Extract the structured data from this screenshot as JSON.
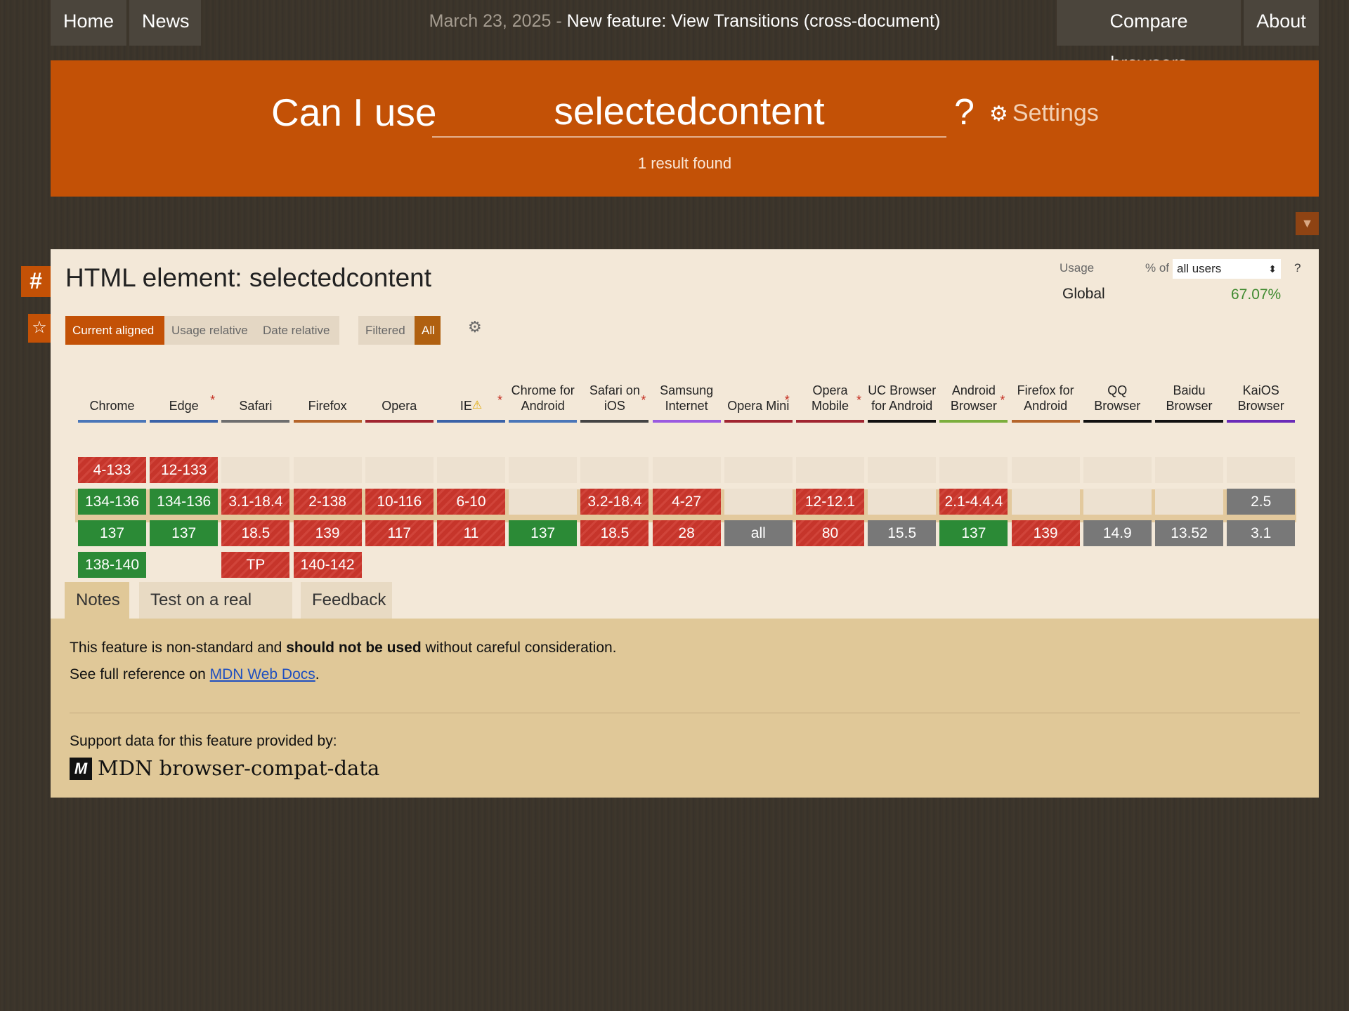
{
  "nav": {
    "home": "Home",
    "news": "News",
    "compare": "Compare browsers",
    "about": "About",
    "announce_date": "March 23, 2025 - ",
    "announce_text": "New feature: View Transitions (cross-document)"
  },
  "hero": {
    "prefix": "Can I use",
    "query": "selectedcontent",
    "qmark": "?",
    "settings": "Settings",
    "result": "1 result found"
  },
  "feature": {
    "title": "HTML element: selectedcontent",
    "usage_label": "Usage",
    "pct_of": "% of",
    "users_select": "all users",
    "usage_help": "?",
    "region": "Global",
    "region_pct": "67.07%"
  },
  "view_tabs": {
    "current_aligned": "Current aligned",
    "usage_relative": "Usage relative",
    "date_relative": "Date relative",
    "filtered": "Filtered",
    "all": "All"
  },
  "colors": {
    "orange": "#c35106",
    "supported": "#2b8a36",
    "unsupported": "#c6352b",
    "unknown": "#787878"
  },
  "browsers": [
    {
      "name": "Chrome",
      "star": false,
      "bar": "#4a76b8",
      "cells": [
        [
          "4-133",
          "n"
        ],
        [
          "134-136",
          "y"
        ],
        [
          "137",
          "y"
        ],
        [
          "138-140",
          "y"
        ]
      ]
    },
    {
      "name": "Edge",
      "star": true,
      "bar": "#3b63a8",
      "cells": [
        [
          "12-133",
          "n"
        ],
        [
          "134-136",
          "y"
        ],
        [
          "137",
          "y"
        ],
        [
          "",
          ""
        ]
      ]
    },
    {
      "name": "Safari",
      "star": false,
      "bar": "#6e6e6e",
      "cells": [
        [
          "",
          "e"
        ],
        [
          "3.1-18.4",
          "n"
        ],
        [
          "18.5",
          "n"
        ],
        [
          "TP",
          "n"
        ]
      ]
    },
    {
      "name": "Firefox",
      "star": false,
      "bar": "#b5652a",
      "cells": [
        [
          "",
          "e"
        ],
        [
          "2-138",
          "n"
        ],
        [
          "139",
          "n"
        ],
        [
          "140-142",
          "n"
        ]
      ]
    },
    {
      "name": "Opera",
      "star": false,
      "bar": "#a02530",
      "cells": [
        [
          "",
          "e"
        ],
        [
          "10-116",
          "n"
        ],
        [
          "117",
          "n"
        ],
        [
          "",
          ""
        ]
      ]
    },
    {
      "name": "IE",
      "star": true,
      "warn": true,
      "bar": "#3b63a8",
      "cells": [
        [
          "",
          "e"
        ],
        [
          "6-10",
          "n"
        ],
        [
          "11",
          "n"
        ],
        [
          "",
          ""
        ]
      ]
    },
    {
      "name": "Chrome for Android",
      "star": false,
      "bar": "#4a76b8",
      "cells": [
        [
          "",
          "e"
        ],
        [
          "",
          "e"
        ],
        [
          "137",
          "y"
        ],
        [
          "",
          ""
        ]
      ]
    },
    {
      "name": "Safari on iOS",
      "star": true,
      "bar": "#444444",
      "cells": [
        [
          "",
          "e"
        ],
        [
          "3.2-18.4",
          "n"
        ],
        [
          "18.5",
          "n"
        ],
        [
          "",
          ""
        ]
      ]
    },
    {
      "name": "Samsung Internet",
      "star": false,
      "bar": "#9a5ae0",
      "cells": [
        [
          "",
          "e"
        ],
        [
          "4-27",
          "n"
        ],
        [
          "28",
          "n"
        ],
        [
          "",
          ""
        ]
      ]
    },
    {
      "name": "Opera Mini",
      "star": true,
      "bar": "#a02530",
      "cells": [
        [
          "",
          "e"
        ],
        [
          "",
          "e"
        ],
        [
          "all",
          "u"
        ],
        [
          "",
          ""
        ]
      ]
    },
    {
      "name": "Opera Mobile",
      "star": true,
      "bar": "#a02530",
      "cells": [
        [
          "",
          "e"
        ],
        [
          "12-12.1",
          "n"
        ],
        [
          "80",
          "n"
        ],
        [
          "",
          ""
        ]
      ]
    },
    {
      "name": "UC Browser for Android",
      "star": false,
      "bar": "#111111",
      "cells": [
        [
          "",
          "e"
        ],
        [
          "",
          "e"
        ],
        [
          "15.5",
          "u"
        ],
        [
          "",
          ""
        ]
      ]
    },
    {
      "name": "Android Browser",
      "star": true,
      "bar": "#7bae3c",
      "cells": [
        [
          "",
          "e"
        ],
        [
          "2.1-4.4.4",
          "n"
        ],
        [
          "137",
          "y"
        ],
        [
          "",
          ""
        ]
      ]
    },
    {
      "name": "Firefox for Android",
      "star": false,
      "bar": "#b5652a",
      "cells": [
        [
          "",
          "e"
        ],
        [
          "",
          "e"
        ],
        [
          "139",
          "n"
        ],
        [
          "",
          ""
        ]
      ]
    },
    {
      "name": "QQ Browser",
      "star": false,
      "bar": "#111111",
      "cells": [
        [
          "",
          "e"
        ],
        [
          "",
          "e"
        ],
        [
          "14.9",
          "u"
        ],
        [
          "",
          ""
        ]
      ]
    },
    {
      "name": "Baidu Browser",
      "star": false,
      "bar": "#111111",
      "cells": [
        [
          "",
          "e"
        ],
        [
          "",
          "e"
        ],
        [
          "13.52",
          "u"
        ],
        [
          "",
          ""
        ]
      ]
    },
    {
      "name": "KaiOS Browser",
      "star": false,
      "bar": "#6a2bb8",
      "cells": [
        [
          "",
          "e"
        ],
        [
          "2.5",
          "u"
        ],
        [
          "3.1",
          "u"
        ],
        [
          "",
          ""
        ]
      ]
    }
  ],
  "bottom_tabs": {
    "notes": "Notes",
    "test": "Test on a real browser",
    "feedback": "Feedback"
  },
  "notes": {
    "line1_a": "This feature is non-standard and ",
    "line1_b": "should not be used",
    "line1_c": " without careful consideration.",
    "line2_a": "See full reference on ",
    "line2_link": "MDN Web Docs",
    "line2_b": ".",
    "support_by": "Support data for this feature provided by:",
    "mdn_logo": "M",
    "mdn_text": "MDN browser-compat-data"
  }
}
